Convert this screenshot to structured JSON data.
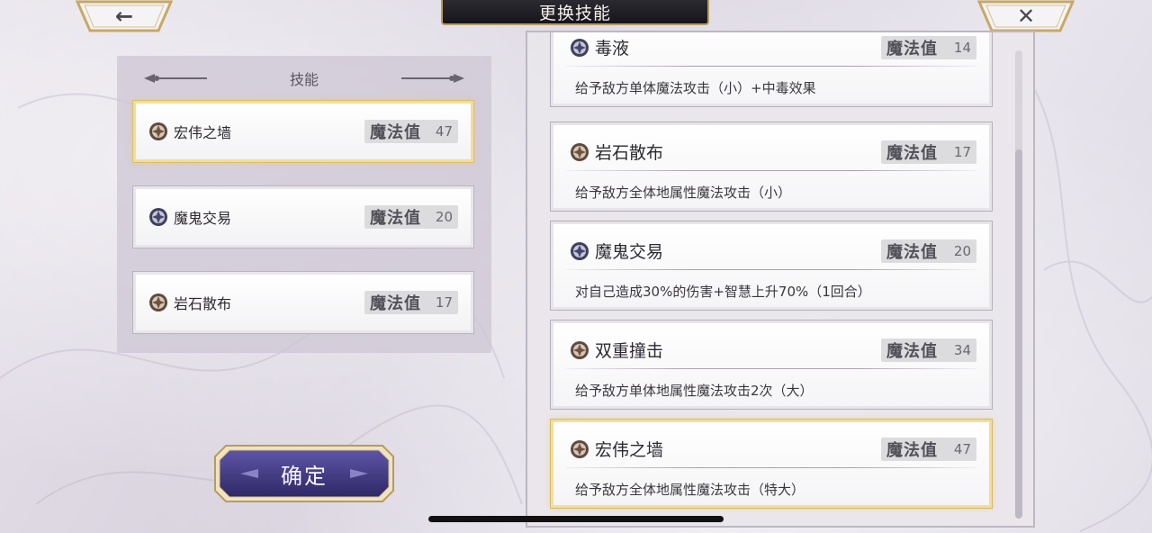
{
  "screen": {
    "title": "更换技能"
  },
  "nav": {
    "back_glyph": "←",
    "close_glyph": "✕"
  },
  "left_panel": {
    "header": "技能",
    "equipped": [
      {
        "name": "宏伟之墙",
        "cost_label": "魔法值",
        "cost": "47",
        "icon": "earth-element-icon",
        "selected": true
      },
      {
        "name": "魔鬼交易",
        "cost_label": "魔法值",
        "cost": "20",
        "icon": "dark-element-icon",
        "selected": false
      },
      {
        "name": "岩石散布",
        "cost_label": "魔法值",
        "cost": "17",
        "icon": "earth-element-icon",
        "selected": false
      }
    ]
  },
  "confirm_button": {
    "label": "确定"
  },
  "skill_list": {
    "items": [
      {
        "name": "毒液",
        "cost_label": "魔法值",
        "cost": "14",
        "description": "给予敌方单体魔法攻击（小）+中毒效果",
        "icon": "dark-element-icon",
        "selected": false
      },
      {
        "name": "岩石散布",
        "cost_label": "魔法值",
        "cost": "17",
        "description": "给予敌方全体地属性魔法攻击（小）",
        "icon": "earth-element-icon",
        "selected": false
      },
      {
        "name": "魔鬼交易",
        "cost_label": "魔法值",
        "cost": "20",
        "description": "对自己造成30%的伤害+智慧上升70%（1回合）",
        "icon": "dark-element-icon",
        "selected": false
      },
      {
        "name": "双重撞击",
        "cost_label": "魔法值",
        "cost": "34",
        "description": "给予敌方单体地属性魔法攻击2次（大）",
        "icon": "earth-element-icon",
        "selected": false
      },
      {
        "name": "宏伟之墙",
        "cost_label": "魔法值",
        "cost": "47",
        "description": "给予敌方全体地属性魔法攻击（特大）",
        "icon": "earth-element-icon",
        "selected": true
      }
    ],
    "scroll_position": 1.0
  },
  "colors": {
    "gold_border": "#f2de9a",
    "title_plate": "#1f1e24",
    "confirm_fill": "#4a3f86"
  }
}
